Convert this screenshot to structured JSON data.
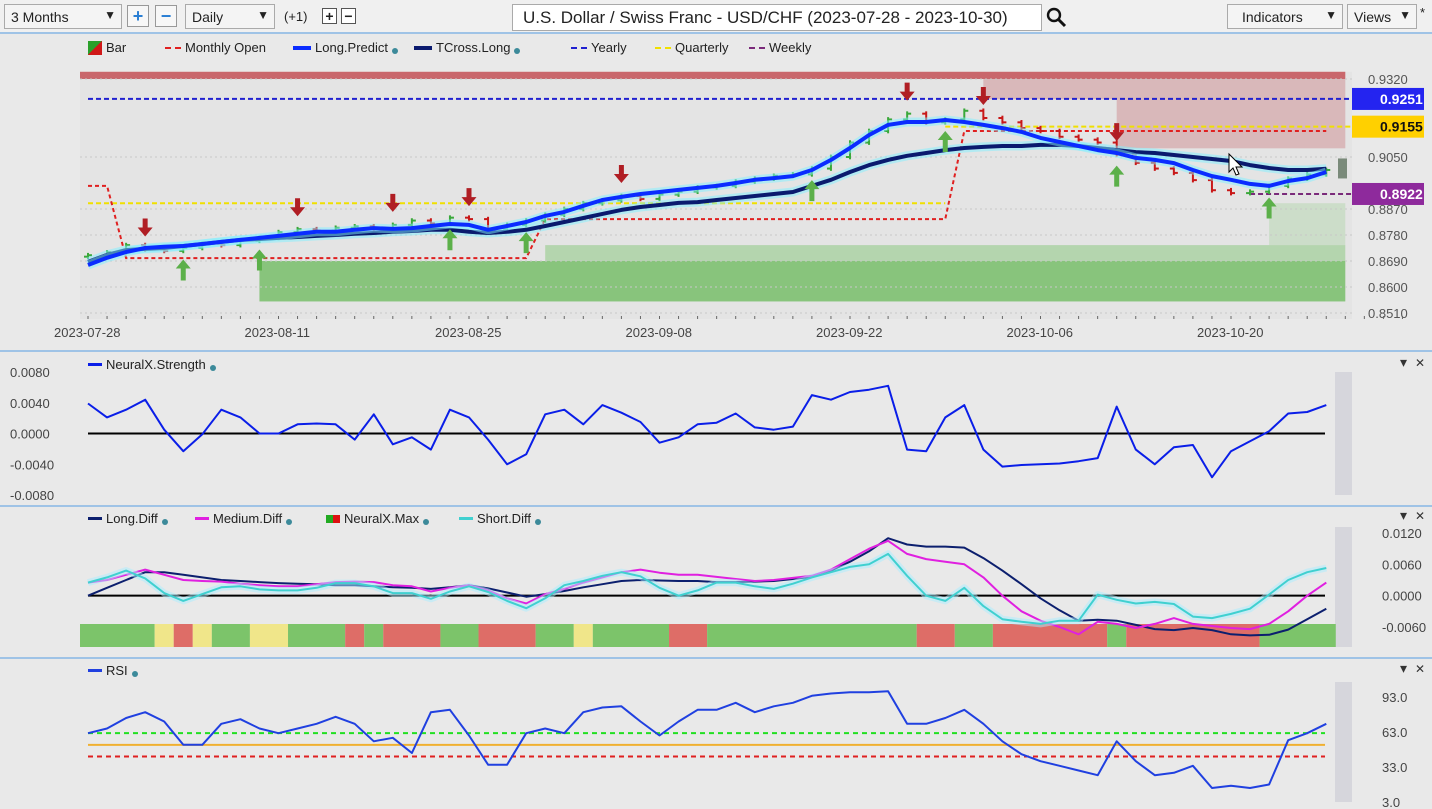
{
  "toolbar": {
    "range": "3 Months",
    "interval": "Daily",
    "offset": "(+1)",
    "title": "U.S. Dollar / Swiss Franc - USD/CHF (2023-07-28 - 2023-10-30)",
    "indicators": "Indicators",
    "views": "Views",
    "star": "*",
    "plus": "+",
    "minus": "−"
  },
  "colors": {
    "long_predict": "#0a2cff",
    "tcross_long": "#0a1a6e",
    "yearly": "#2020d0",
    "quarterly": "#f0e000",
    "weekly": "#7a2a7a",
    "monthly_open": "#e02020",
    "up": "#3aa83a",
    "down": "#c81818",
    "tag_yearly": "#2424f0",
    "tag_quarterly": "#ffd000",
    "tag_weekly": "#8e2a9c"
  },
  "chart_data": [
    {
      "type": "line",
      "panel": "price",
      "legend": [
        "Bar",
        "Monthly Open",
        "Long.Predict",
        "TCross.Long",
        "Yearly",
        "Quarterly",
        "Weekly"
      ],
      "x_ticks": [
        {
          "i": 0,
          "label": "2023-07-28"
        },
        {
          "i": 10,
          "label": "2023-08-11"
        },
        {
          "i": 20,
          "label": "2023-08-25"
        },
        {
          "i": 30,
          "label": "2023-09-08"
        },
        {
          "i": 40,
          "label": "2023-09-22"
        },
        {
          "i": 50,
          "label": "2023-10-06"
        },
        {
          "i": 60,
          "label": "2023-10-20"
        }
      ],
      "y_ticks": [
        "0.9320",
        "0.9050",
        "0.8870",
        "0.8780",
        "0.8690",
        "0.8600",
        "0.8510"
      ],
      "ylim": [
        0.851,
        0.932
      ],
      "price_tags": [
        {
          "value": 0.9251,
          "label": "0.9251",
          "color": "tag_yearly"
        },
        {
          "value": 0.9155,
          "label": "0.9155",
          "color": "tag_quarterly"
        },
        {
          "value": 0.8922,
          "label": "0.8922",
          "color": "tag_weekly"
        }
      ],
      "close": [
        0.871,
        0.872,
        0.8745,
        0.873,
        0.8725,
        0.8735,
        0.875,
        0.8745,
        0.876,
        0.877,
        0.879,
        0.88,
        0.8795,
        0.8805,
        0.881,
        0.88,
        0.8815,
        0.883,
        0.882,
        0.884,
        0.8835,
        0.88,
        0.8815,
        0.883,
        0.885,
        0.887,
        0.889,
        0.89,
        0.8915,
        0.8905,
        0.892,
        0.893,
        0.8945,
        0.895,
        0.8965,
        0.8975,
        0.8985,
        0.899,
        0.901,
        0.905,
        0.91,
        0.914,
        0.918,
        0.92,
        0.917,
        0.918,
        0.921,
        0.9185,
        0.917,
        0.915,
        0.914,
        0.912,
        0.911,
        0.91,
        0.906,
        0.903,
        0.901,
        0.8995,
        0.897,
        0.8935,
        0.8925,
        0.893,
        0.895,
        0.8975,
        0.899,
        0.9005
      ],
      "long_predict": [
        0.8676,
        0.8701,
        0.8721,
        0.8735,
        0.8739,
        0.8742,
        0.8749,
        0.8756,
        0.8763,
        0.877,
        0.8777,
        0.8784,
        0.8791,
        0.8791,
        0.8798,
        0.8804,
        0.8801,
        0.8804,
        0.8811,
        0.8818,
        0.8815,
        0.8798,
        0.8811,
        0.8825,
        0.8846,
        0.886,
        0.8881,
        0.8901,
        0.8912,
        0.8922,
        0.8929,
        0.8936,
        0.8943,
        0.895,
        0.896,
        0.8971,
        0.8977,
        0.8984,
        0.9005,
        0.904,
        0.9081,
        0.9126,
        0.9161,
        0.9171,
        0.9171,
        0.9178,
        0.9171,
        0.9161,
        0.915,
        0.9137,
        0.9116,
        0.9102,
        0.9088,
        0.9074,
        0.9064,
        0.9047,
        0.904,
        0.9029,
        0.9005,
        0.8984,
        0.8971,
        0.8957,
        0.895,
        0.8967,
        0.8977,
        0.8998
      ],
      "tcross_long": [
        0.8687,
        0.8711,
        0.8728,
        0.8732,
        0.8735,
        0.8742,
        0.8749,
        0.8756,
        0.8763,
        0.8766,
        0.877,
        0.8773,
        0.8777,
        0.878,
        0.8784,
        0.8787,
        0.8791,
        0.8794,
        0.8798,
        0.8798,
        0.8791,
        0.8787,
        0.8791,
        0.8798,
        0.8811,
        0.8825,
        0.8839,
        0.8853,
        0.8867,
        0.8877,
        0.8884,
        0.8891,
        0.8894,
        0.8901,
        0.8908,
        0.8915,
        0.8922,
        0.8929,
        0.895,
        0.8971,
        0.8998,
        0.9022,
        0.904,
        0.9054,
        0.9064,
        0.9074,
        0.9081,
        0.9085,
        0.9088,
        0.9088,
        0.9092,
        0.9092,
        0.9088,
        0.9081,
        0.9074,
        0.9067,
        0.9064,
        0.9057,
        0.905,
        0.9043,
        0.9036,
        0.9022,
        0.9012,
        0.9005,
        0.9005,
        0.9009
      ],
      "yearly": 0.9251,
      "quarterly": [
        {
          "from": 0,
          "to": 45,
          "value": 0.889
        },
        {
          "from": 45,
          "to": 65,
          "value": 0.9155
        }
      ],
      "weekly": {
        "from": 61,
        "to": 65,
        "value": 0.8922
      },
      "monthly_open": [
        {
          "from": 0,
          "to": 1,
          "value": 0.895
        },
        {
          "from": 2,
          "to": 23,
          "value": 0.87
        },
        {
          "from": 24,
          "to": 45,
          "value": 0.8835
        },
        {
          "from": 46,
          "to": 65,
          "value": 0.914
        }
      ],
      "down_arrows": [
        3,
        11,
        16,
        20,
        28,
        43,
        47,
        54
      ],
      "up_arrows": [
        5,
        9,
        19,
        23,
        38,
        45,
        54,
        62
      ],
      "zones": [
        {
          "from": -0.5,
          "to": 66,
          "low": 0.932,
          "high": 0.9345,
          "kind": "resistance-strong"
        },
        {
          "from": 47,
          "to": 66,
          "low": 0.925,
          "high": 0.932,
          "kind": "resistance"
        },
        {
          "from": 54,
          "to": 66,
          "low": 0.908,
          "high": 0.925,
          "kind": "resistance"
        },
        {
          "from": 9,
          "to": 66,
          "low": 0.855,
          "high": 0.869,
          "kind": "support-strong"
        },
        {
          "from": 24,
          "to": 66,
          "low": 0.869,
          "high": 0.8745,
          "kind": "support"
        },
        {
          "from": 62,
          "to": 66,
          "low": 0.8745,
          "high": 0.889,
          "kind": "support-light"
        }
      ]
    },
    {
      "type": "line",
      "panel": "strength",
      "legend": [
        "NeuralX.Strength"
      ],
      "y_ticks": [
        "0.0080",
        "0.0040",
        "0.0000",
        "-0.0040",
        "-0.0080"
      ],
      "ylim": [
        -0.008,
        0.008
      ],
      "values": [
        0.0039,
        0.0021,
        0.0031,
        0.0044,
        0.0005,
        -0.0023,
        -0.0001,
        0.0031,
        0.0021,
        0,
        0,
        0.0012,
        0.0013,
        0.0012,
        -0.0008,
        0.0025,
        -0.0014,
        -0.0005,
        -0.0021,
        0.0031,
        0.0021,
        -0.0008,
        -0.004,
        -0.0027,
        0.0025,
        0.0031,
        0.0012,
        0.0037,
        0.0027,
        0.0015,
        -0.0012,
        -0.0005,
        0.0012,
        0.0014,
        0.0026,
        0.0008,
        0.0005,
        0.0009,
        0.005,
        0.0044,
        0.0054,
        0.0057,
        0.0062,
        -0.0021,
        -0.0023,
        0.0021,
        0.0037,
        -0.0021,
        -0.0043,
        -0.0041,
        -0.004,
        -0.0039,
        -0.0036,
        -0.0032,
        0.0035,
        -0.0021,
        -0.004,
        -0.0018,
        -0.0015,
        -0.0057,
        -0.0023,
        -0.001,
        0.0003,
        0.0026,
        0.0028,
        0.0037
      ]
    },
    {
      "type": "line",
      "panel": "diff",
      "legend": [
        "Long.Diff",
        "Medium.Diff",
        "NeuralX.Max",
        "Short.Diff"
      ],
      "y_ticks": [
        "0.0120",
        "0.0060",
        "0.0000",
        "-0.0060"
      ],
      "ylim": [
        -0.008,
        0.0125
      ],
      "series": [
        {
          "name": "Long.Diff",
          "color": "#0c1f6e",
          "values": [
            0,
            0.0015,
            0.003,
            0.0045,
            0.0045,
            0.004,
            0.0035,
            0.003,
            0.0028,
            0.0026,
            0.0024,
            0.0023,
            0.0022,
            0.002,
            0.002,
            0.0018,
            0.0016,
            0.0015,
            0.0013,
            0.0016,
            0.002,
            0.0014,
            0.0006,
            -0.0002,
            0.0003,
            0.0009,
            0.0016,
            0.0022,
            0.0028,
            0.003,
            0.0029,
            0.0028,
            0.0028,
            0.0026,
            0.0026,
            0.0027,
            0.0028,
            0.0032,
            0.0036,
            0.0048,
            0.0065,
            0.0085,
            0.011,
            0.0098,
            0.0094,
            0.0094,
            0.0092,
            0.0072,
            0.0048,
            0.0022,
            -0.0005,
            -0.0028,
            -0.0048,
            -0.0046,
            -0.0048,
            -0.0056,
            -0.0064,
            -0.0066,
            -0.0062,
            -0.0066,
            -0.0074,
            -0.0076,
            -0.0075,
            -0.0065,
            -0.0045,
            -0.0025
          ]
        },
        {
          "name": "Medium.Diff",
          "color": "#e020e0",
          "values": [
            0.0025,
            0.003,
            0.004,
            0.005,
            0.004,
            0.003,
            0.0028,
            0.0027,
            0.0023,
            0.002,
            0.0018,
            0.0018,
            0.0022,
            0.0026,
            0.0027,
            0.0026,
            0.002,
            0.0018,
            0.0008,
            0.0015,
            0.002,
            0.001,
            -0.0005,
            -0.0015,
            0.0003,
            0.0013,
            0.0025,
            0.0035,
            0.0045,
            0.005,
            0.0044,
            0.004,
            0.004,
            0.0036,
            0.0032,
            0.0028,
            0.003,
            0.0034,
            0.0038,
            0.005,
            0.007,
            0.009,
            0.0105,
            0.008,
            0.007,
            0.0065,
            0.006,
            0.0035,
            0,
            -0.003,
            -0.0048,
            -0.006,
            -0.0074,
            -0.005,
            -0.0054,
            -0.0062,
            -0.0054,
            -0.0043,
            -0.0054,
            -0.0058,
            -0.0062,
            -0.0064,
            -0.0054,
            -0.003,
            0,
            0.0025
          ]
        },
        {
          "name": "Short.Diff",
          "color": "#40d0d0",
          "values": [
            0.0025,
            0.0035,
            0.0048,
            0.0033,
            0.0005,
            -0.001,
            0.0003,
            0.0016,
            0.0018,
            0.0012,
            0.001,
            0.001,
            0.0015,
            0.0024,
            0.0024,
            0.0018,
            0.0005,
            0.0005,
            -0.0006,
            0.0008,
            0.0018,
            0.0007,
            -0.001,
            -0.0024,
            -0.0005,
            0.002,
            0.0028,
            0.0038,
            0.0045,
            0.0037,
            0.0015,
            0,
            0.001,
            0.0025,
            0.0025,
            0.0018,
            0.0013,
            0.0023,
            0.0035,
            0.0045,
            0.0055,
            0.006,
            0.008,
            0.0038,
            0,
            -0.001,
            0.0015,
            -0.002,
            -0.0045,
            -0.005,
            -0.0054,
            -0.0048,
            -0.0048,
            0.0002,
            -0.0008,
            -0.0015,
            -0.0012,
            -0.0016,
            -0.004,
            -0.0043,
            -0.0035,
            -0.0025,
            0.0002,
            0.003,
            0.0045,
            0.0053
          ]
        }
      ],
      "neuralx_max": [
        [
          "green",
          4
        ],
        [
          "yellow",
          1
        ],
        [
          "red",
          1
        ],
        [
          "yellow",
          1
        ],
        [
          "green",
          2
        ],
        [
          "yellow",
          2
        ],
        [
          "green",
          3
        ],
        [
          "red",
          1
        ],
        [
          "green",
          1
        ],
        [
          "red",
          3
        ],
        [
          "green",
          2
        ],
        [
          "red",
          3
        ],
        [
          "green",
          2
        ],
        [
          "yellow",
          1
        ],
        [
          "green",
          4
        ],
        [
          "red",
          2
        ],
        [
          "green",
          11
        ],
        [
          "red",
          2
        ],
        [
          "green",
          2
        ],
        [
          "red",
          6
        ],
        [
          "green",
          1
        ],
        [
          "red",
          7
        ],
        [
          "green",
          4
        ]
      ],
      "state_colors": {
        "green": "#7cc46a",
        "yellow": "#f0e68a",
        "red": "#de6d67"
      }
    },
    {
      "type": "line",
      "panel": "rsi",
      "legend": [
        "RSI"
      ],
      "y_ticks": [
        "93.0",
        "63.0",
        "33.0",
        "3.0"
      ],
      "ylim": [
        3,
        100
      ],
      "levels": [
        {
          "value": 62,
          "color": "#22e022",
          "style": "dashed"
        },
        {
          "value": 52,
          "color": "#f0b030",
          "style": "solid"
        },
        {
          "value": 42,
          "color": "#e02020",
          "style": "dashed"
        }
      ],
      "values": [
        62,
        66,
        75,
        80,
        72,
        52,
        52,
        70,
        74,
        66,
        62,
        66,
        70,
        76,
        70,
        55,
        58,
        45,
        80,
        82,
        60,
        35,
        35,
        62,
        66,
        62,
        80,
        84,
        85,
        72,
        60,
        72,
        82,
        82,
        88,
        80,
        85,
        88,
        94,
        96,
        97,
        97,
        98,
        70,
        70,
        75,
        82,
        70,
        55,
        44,
        38,
        34,
        30,
        26,
        55,
        38,
        26,
        28,
        34,
        15,
        17,
        15,
        18,
        56,
        62,
        70
      ]
    }
  ]
}
